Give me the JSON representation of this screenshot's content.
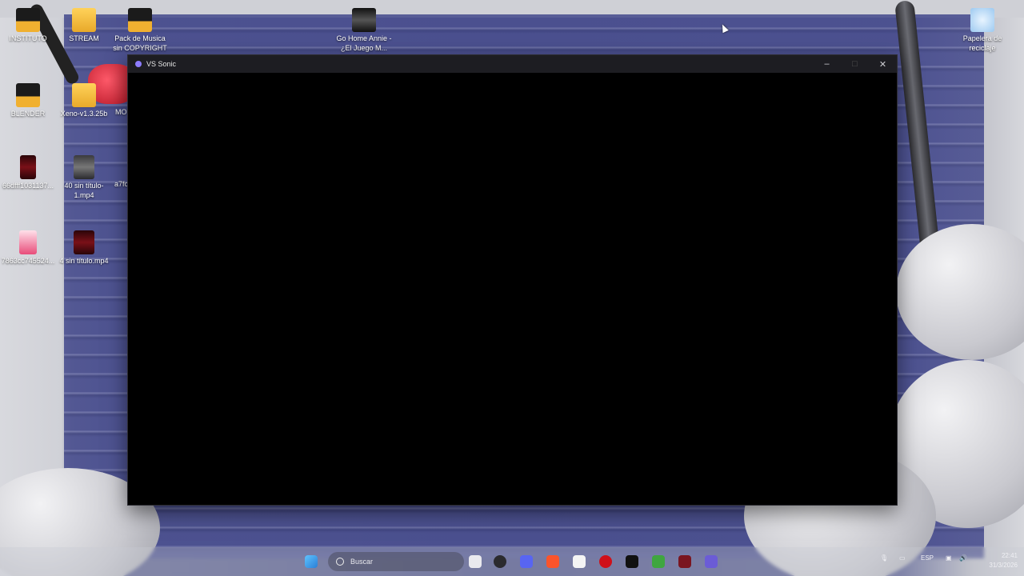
{
  "desktop": {
    "icons": [
      {
        "label": "INSTITUTO"
      },
      {
        "label": "STREAM"
      },
      {
        "label": "Pack de Musica sin COPYRIGHT"
      },
      {
        "label": "Go Home Annie - ¿El Juego M..."
      },
      {
        "label": "Papelera de reciclaje"
      },
      {
        "label": "BLENDER"
      },
      {
        "label": "Xeno-v1.3.25b"
      },
      {
        "label": "MO"
      },
      {
        "label": "66dfff1031137..."
      },
      {
        "label": "40 sin título-1.mp4"
      },
      {
        "label": "a7fc"
      },
      {
        "label": "7863cc745524..."
      },
      {
        "label": "4 sin título.mp4"
      }
    ]
  },
  "window": {
    "title": "VS Sonic",
    "minimize": "–",
    "maximize": "□",
    "close": "✕"
  },
  "taskbar": {
    "search_placeholder": "Buscar",
    "apps": [
      "start-icon",
      "file-icon",
      "obs-icon",
      "discord-icon",
      "brave-icon",
      "capcut-icon",
      "red-app-icon",
      "tiktok-icon",
      "minecraft-icon",
      "valorant-icon",
      "vs-sonic-icon"
    ],
    "language": "ESP",
    "time": "22:41",
    "date": "31/3/2026"
  },
  "colors": {
    "discord": "#5865f2",
    "brave": "#fb542b",
    "minecraft": "#3fa63f",
    "start": "#3a9be8"
  }
}
